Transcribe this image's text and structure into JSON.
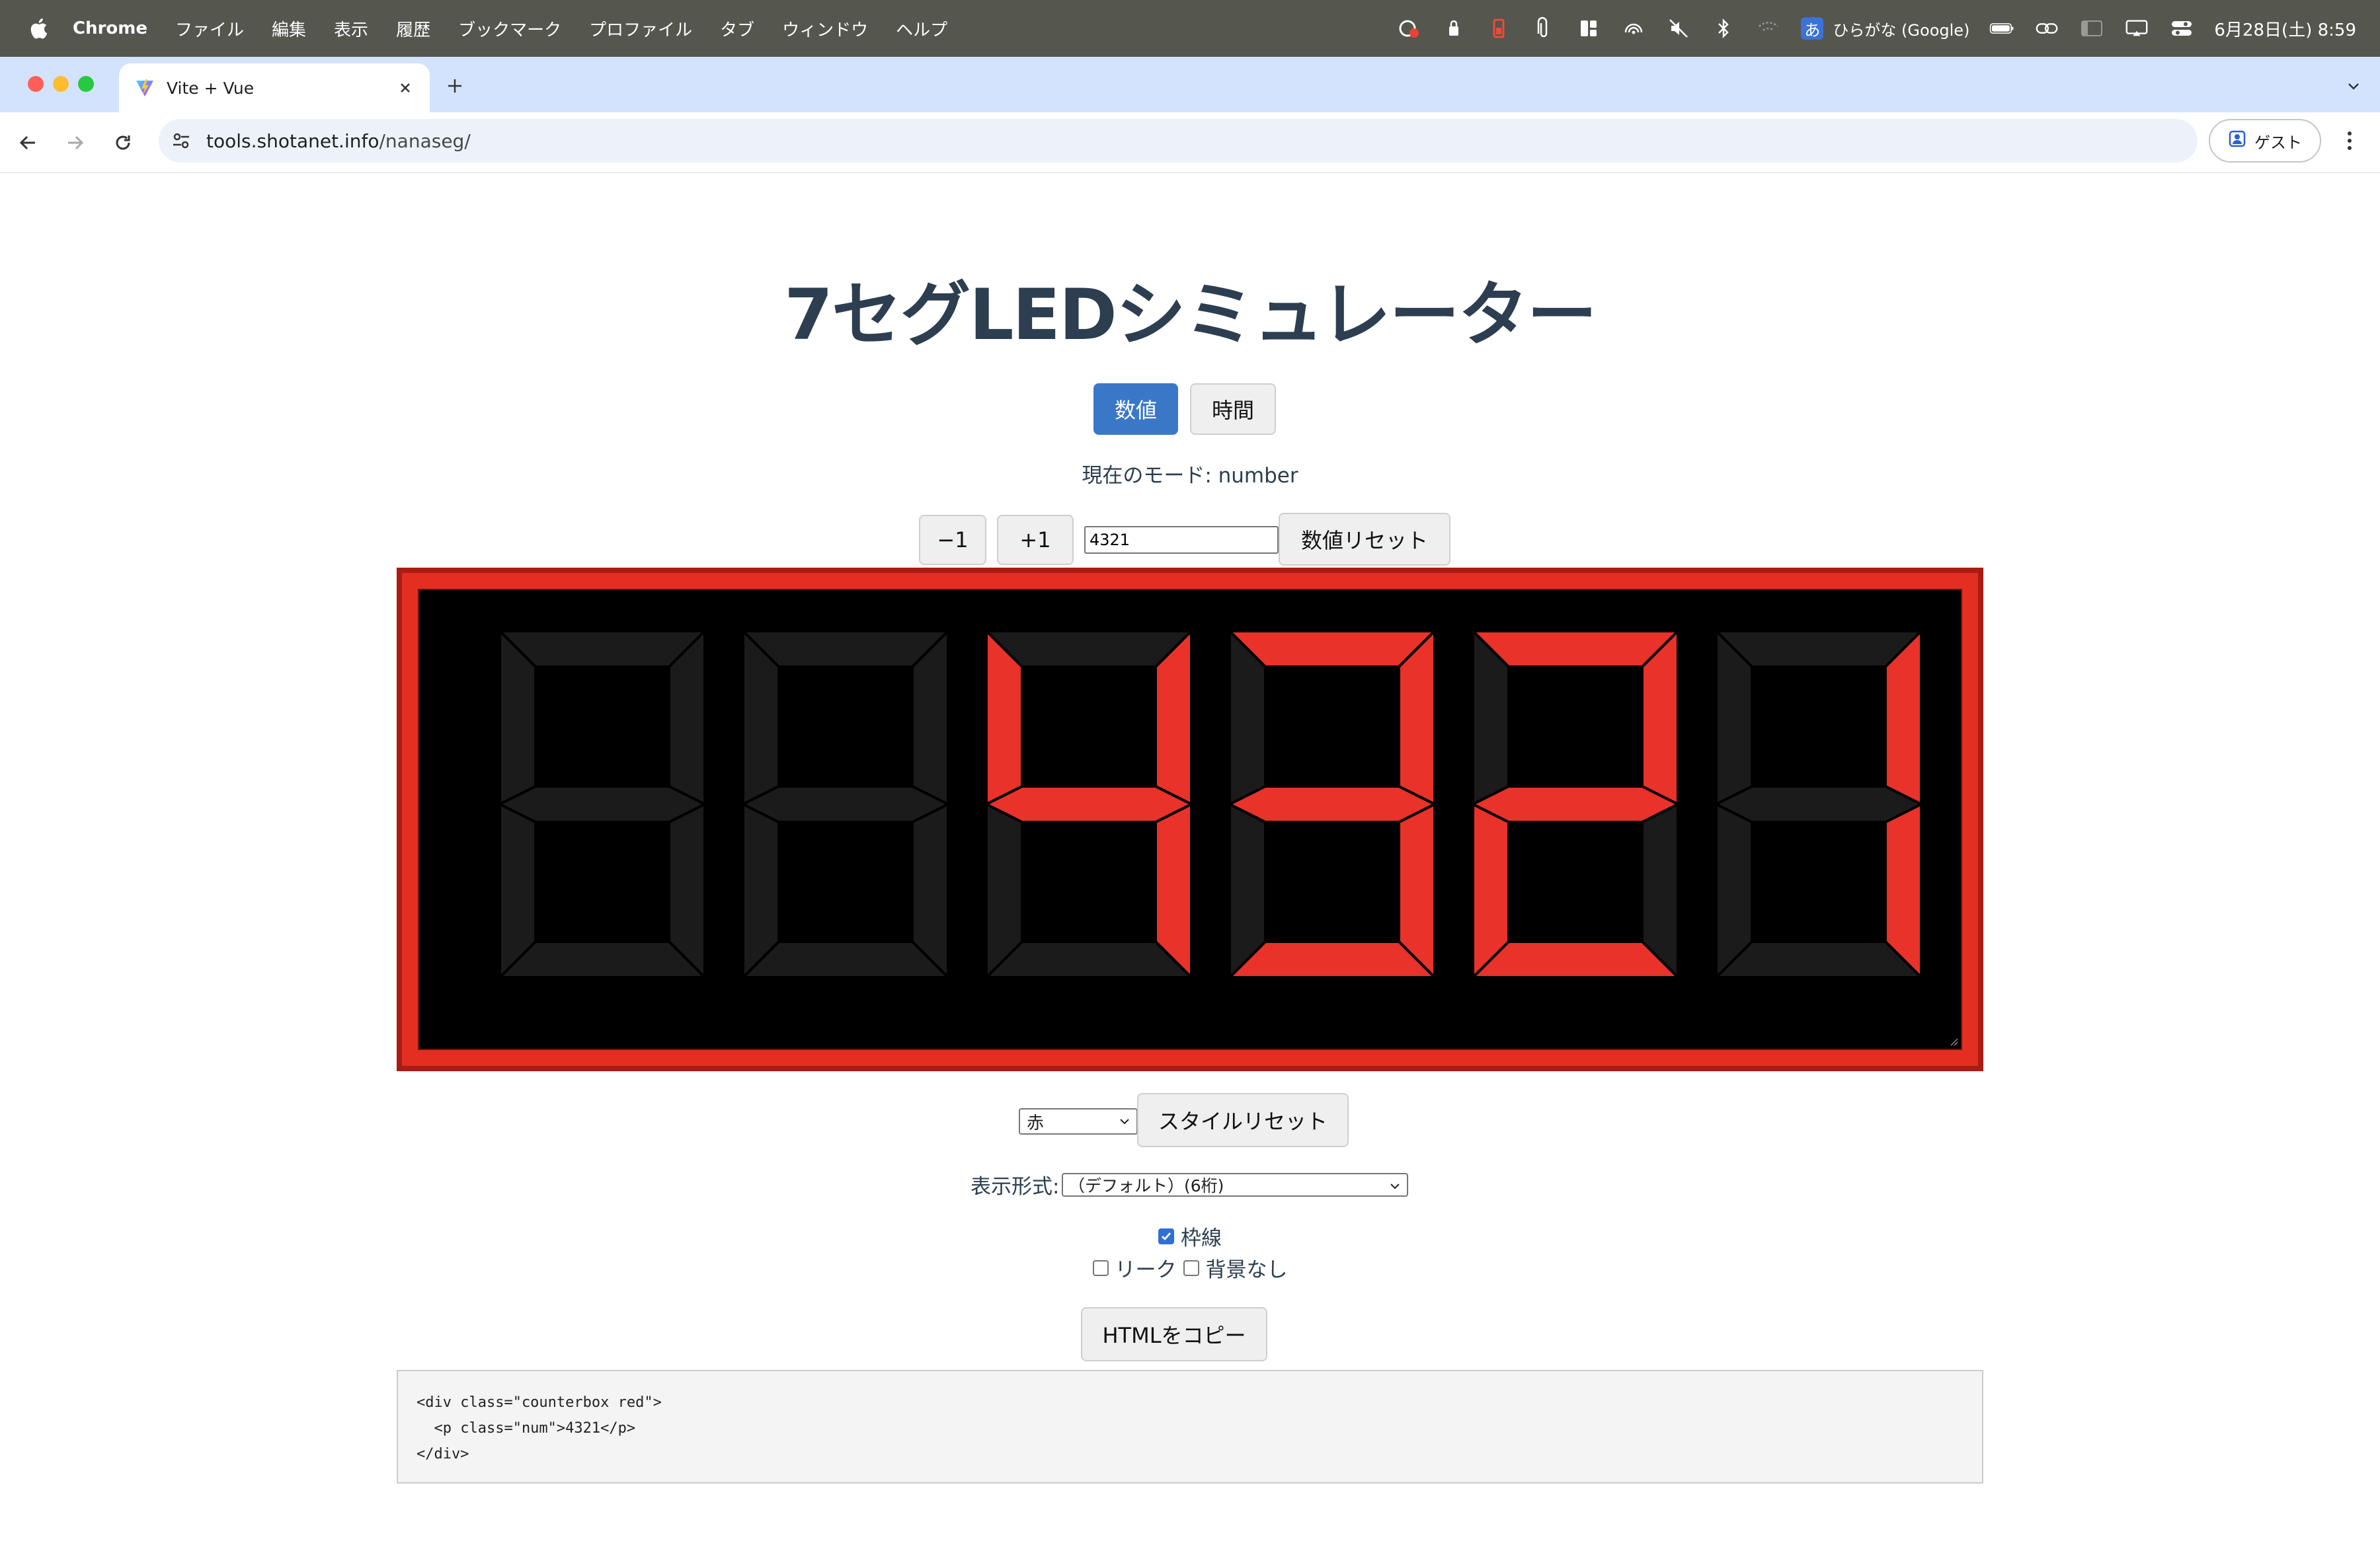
{
  "menubar": {
    "app": "Chrome",
    "items": [
      "ファイル",
      "編集",
      "表示",
      "履歴",
      "ブックマーク",
      "プロファイル",
      "タブ",
      "ウィンドウ",
      "ヘルプ"
    ],
    "ime": "ひらがな (Google)",
    "ime_glyph": "あ",
    "clock": "6月28日(土) 8:59"
  },
  "browser": {
    "tab_title": "Vite + Vue",
    "url_host": "tools.shotanet.info",
    "url_path": "/nanaseg/",
    "guest_label": "ゲスト"
  },
  "page": {
    "title": "7セグLEDシミュレーター",
    "mode_buttons": [
      {
        "label": "数値",
        "active": true
      },
      {
        "label": "時間",
        "active": false
      }
    ],
    "mode_line": "現在のモード: number",
    "decrement_label": "−1",
    "increment_label": "+1",
    "number_value": "4321",
    "reset_number_label": "数値リセット",
    "color_select": {
      "selected": "赤"
    },
    "reset_style_label": "スタイルリセット",
    "format_label": "表示形式:",
    "format_select": {
      "selected": "（デフォルト）(6桁)"
    },
    "checkboxes": [
      {
        "label": "枠線",
        "checked": true
      },
      {
        "label": "リーク",
        "checked": false
      },
      {
        "label": "背景なし",
        "checked": false
      }
    ],
    "copy_label": "HTMLをコピー",
    "code_lines": [
      "<div class=\"counterbox red\">",
      "  <p class=\"num\">4321</p>",
      "</div>"
    ]
  },
  "led": {
    "digit_count": 6,
    "on_color": "#e8322a",
    "off_color": "#1b1b1b",
    "panel_color": "#e42e21",
    "digits": [
      {
        "char": "",
        "segments": {
          "a": false,
          "b": false,
          "c": false,
          "d": false,
          "e": false,
          "f": false,
          "g": false
        }
      },
      {
        "char": "",
        "segments": {
          "a": false,
          "b": false,
          "c": false,
          "d": false,
          "e": false,
          "f": false,
          "g": false
        }
      },
      {
        "char": "4",
        "segments": {
          "a": false,
          "b": true,
          "c": true,
          "d": false,
          "e": false,
          "f": true,
          "g": true
        }
      },
      {
        "char": "3",
        "segments": {
          "a": true,
          "b": true,
          "c": true,
          "d": true,
          "e": false,
          "f": false,
          "g": true
        }
      },
      {
        "char": "2",
        "segments": {
          "a": true,
          "b": true,
          "c": false,
          "d": true,
          "e": true,
          "f": false,
          "g": true
        }
      },
      {
        "char": "1",
        "segments": {
          "a": false,
          "b": true,
          "c": true,
          "d": false,
          "e": false,
          "f": false,
          "g": false
        }
      }
    ]
  }
}
